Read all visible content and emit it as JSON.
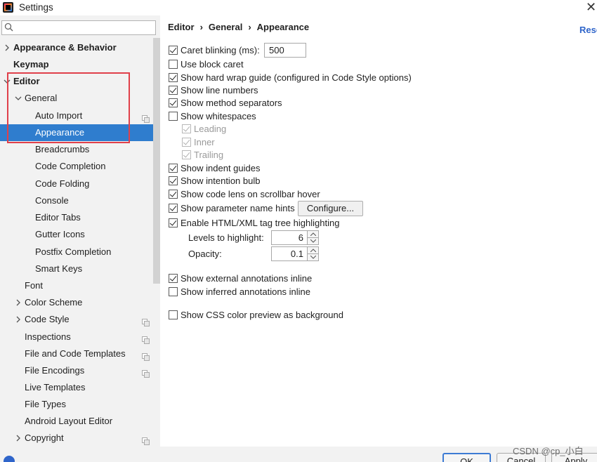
{
  "window": {
    "title": "Settings"
  },
  "search": {
    "placeholder": "",
    "value": ""
  },
  "sidebar": {
    "items": [
      {
        "label": "Appearance & Behavior"
      },
      {
        "label": "Keymap"
      },
      {
        "label": "Editor"
      },
      {
        "label": "General"
      },
      {
        "label": "Auto Import"
      },
      {
        "label": "Appearance"
      },
      {
        "label": "Breadcrumbs"
      },
      {
        "label": "Code Completion"
      },
      {
        "label": "Code Folding"
      },
      {
        "label": "Console"
      },
      {
        "label": "Editor Tabs"
      },
      {
        "label": "Gutter Icons"
      },
      {
        "label": "Postfix Completion"
      },
      {
        "label": "Smart Keys"
      },
      {
        "label": "Font"
      },
      {
        "label": "Color Scheme"
      },
      {
        "label": "Code Style"
      },
      {
        "label": "Inspections"
      },
      {
        "label": "File and Code Templates"
      },
      {
        "label": "File Encodings"
      },
      {
        "label": "Live Templates"
      },
      {
        "label": "File Types"
      },
      {
        "label": "Android Layout Editor"
      },
      {
        "label": "Copyright"
      }
    ]
  },
  "breadcrumb": {
    "part1": "Editor",
    "part2": "General",
    "part3": "Appearance",
    "separator": "›"
  },
  "reset_label": "Rese",
  "options": {
    "caret_blinking": {
      "label": "Caret blinking (ms):",
      "checked": true,
      "value": "500"
    },
    "block_caret": {
      "label": "Use block caret",
      "checked": false
    },
    "hard_wrap": {
      "label": "Show hard wrap guide (configured in Code Style options)",
      "checked": true
    },
    "line_numbers": {
      "label": "Show line numbers",
      "checked": true
    },
    "method_separators": {
      "label": "Show method separators",
      "checked": true
    },
    "whitespaces": {
      "label": "Show whitespaces",
      "checked": false
    },
    "leading": {
      "label": "Leading",
      "checked": true
    },
    "inner": {
      "label": "Inner",
      "checked": true
    },
    "trailing": {
      "label": "Trailing",
      "checked": true
    },
    "indent_guides": {
      "label": "Show indent guides",
      "checked": true
    },
    "intention_bulb": {
      "label": "Show intention bulb",
      "checked": true
    },
    "code_lens": {
      "label": "Show code lens on scrollbar hover",
      "checked": true
    },
    "param_hints": {
      "label": "Show parameter name hints",
      "checked": true,
      "button": "Configure..."
    },
    "tag_tree": {
      "label": "Enable HTML/XML tag tree highlighting",
      "checked": true
    },
    "levels": {
      "label": "Levels to highlight:",
      "value": "6"
    },
    "opacity": {
      "label": "Opacity:",
      "value": "0.1"
    },
    "ext_annotations": {
      "label": "Show external annotations inline",
      "checked": true
    },
    "inf_annotations": {
      "label": "Show inferred annotations inline",
      "checked": false
    },
    "css_color": {
      "label": "Show CSS color preview as background",
      "checked": false
    }
  },
  "buttons": {
    "ok": "OK",
    "cancel": "Cancel",
    "apply": "Apply"
  },
  "watermark": "CSDN @cp_小白",
  "colors": {
    "selection": "#2f7dce",
    "highlight_box": "#e0404a",
    "link": "#2f65ca"
  }
}
